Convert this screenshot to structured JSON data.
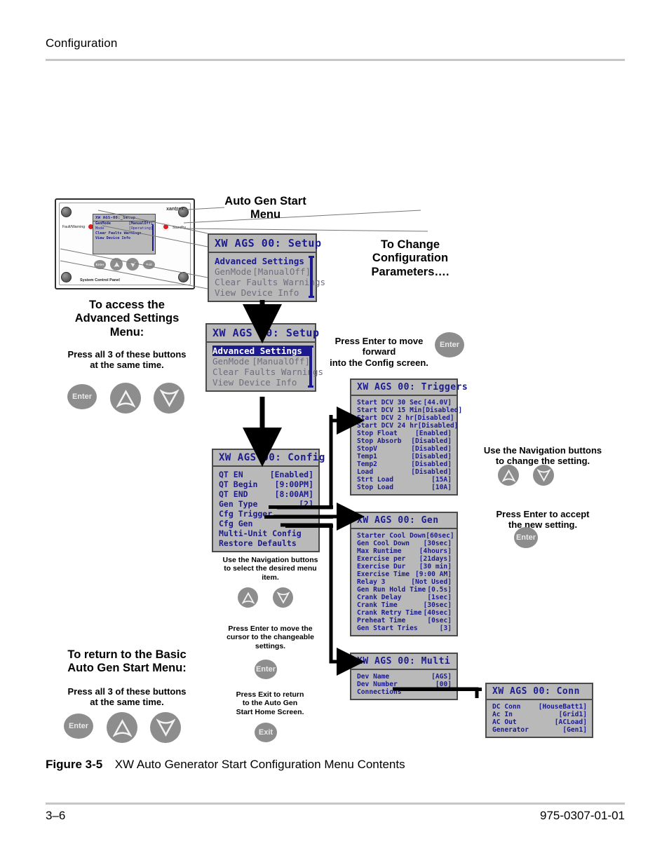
{
  "page": {
    "running_head": "Configuration",
    "figure_label": "Figure 3-5",
    "figure_title": "XW Auto Generator Start Configuration Menu Contents",
    "folio_page": "3–6",
    "folio_doc": "975-0307-01-01"
  },
  "device": {
    "brand": "xantrex",
    "fault_label": "Fault/Warning",
    "standby_label": "Standby",
    "panel_name": "System Control Panel",
    "screen": {
      "title": "XW AGS-00:_Setup",
      "rows": [
        {
          "key": "GenMode",
          "value": "[ManualOff]"
        },
        {
          "key": "Mode",
          "value": "[Operating]"
        },
        {
          "key": "Clear Faults Warnings",
          "value": ""
        },
        {
          "key": "View Device Info",
          "value": ""
        }
      ]
    },
    "buttons": [
      "Enter",
      "up-arrow",
      "down-arrow",
      "Exit"
    ]
  },
  "callouts": {
    "auto_gen_start_menu": "Auto Gen Start\nMenu",
    "to_change_config": "To Change\nConfiguration\nParameters….",
    "access_advanced_title": "To access the\nAdvanced Settings\nMenu:",
    "access_advanced_sub": "Press all 3 of these buttons\nat the same time.",
    "press_enter_forward": "Press Enter to move forward\ninto the Config screen.",
    "nav_change_setting": "Use the Navigation buttons\nto change the setting.",
    "press_enter_accept": "Press Enter to accept\nthe new setting.",
    "nav_select_item": "Use the Navigation buttons\nto select the desired menu\nitem.",
    "press_enter_cursor": "Press Enter to move the\ncursor to the changeable\nsettings.",
    "press_exit_return": "Press Exit to return\nto the Auto Gen\nStart Home Screen.",
    "return_basic_title": "To return to the Basic\nAuto Gen Start Menu:",
    "return_basic_sub": "Press all 3 of these buttons\nat the same time."
  },
  "buttons": {
    "enter": "Enter",
    "exit": "Exit"
  },
  "screens": {
    "setup_top": {
      "title": "XW AGS 00: Setup",
      "rows": [
        {
          "key": "Advanced Settings",
          "value": "",
          "style": "bold"
        },
        {
          "key": "GenMode",
          "value": "[ManualOff]",
          "style": "dim"
        },
        {
          "key": "Clear Faults Warnings",
          "value": "",
          "style": "dim"
        },
        {
          "key": "View Device Info",
          "value": "",
          "style": "dim"
        }
      ]
    },
    "setup_advanced": {
      "title": "XW AGS 00: Setup",
      "rows": [
        {
          "key": "Advanced Settings",
          "value": "",
          "style": "sel"
        },
        {
          "key": "GenMode",
          "value": "[ManualOff]",
          "style": "dim"
        },
        {
          "key": "Clear Faults Warnings",
          "value": "",
          "style": "dim"
        },
        {
          "key": "View Device Info",
          "value": "",
          "style": "dim"
        }
      ]
    },
    "config": {
      "title": "XW AGS 00: Config",
      "rows": [
        {
          "key": "QT EN",
          "value": "[Enabled]"
        },
        {
          "key": "QT Begin",
          "value": "[9:00PM]"
        },
        {
          "key": "QT END",
          "value": "[8:00AM]"
        },
        {
          "key": "Gen Type",
          "value": "[2]"
        },
        {
          "key": "Cfg Trigger",
          "value": ""
        },
        {
          "key": "Cfg Gen",
          "value": ""
        },
        {
          "key": "Multi-Unit Config",
          "value": ""
        },
        {
          "key": "Restore Defaults",
          "value": ""
        }
      ]
    },
    "triggers": {
      "title": "XW AGS 00: Triggers",
      "rows": [
        {
          "key": "Start DCV 30 Sec",
          "value": "[44.0V]"
        },
        {
          "key": "Start DCV 15 Min",
          "value": "[Disabled]"
        },
        {
          "key": "Start DCV 2 hr",
          "value": "[Disabled]"
        },
        {
          "key": "Start DCV 24 hr",
          "value": "[Disabled]"
        },
        {
          "key": "Stop Float",
          "value": "[Enabled]"
        },
        {
          "key": "Stop Absorb",
          "value": "[Disabled]"
        },
        {
          "key": "StopV",
          "value": "[Disabled]"
        },
        {
          "key": "Temp1",
          "value": "[Disabled]"
        },
        {
          "key": "Temp2",
          "value": "[Disabled]"
        },
        {
          "key": "Load",
          "value": "[Disabled]"
        },
        {
          "key": "Strt Load",
          "value": "[15A]"
        },
        {
          "key": "Stop Load",
          "value": "[10A]"
        }
      ]
    },
    "gen": {
      "title": "XW AGS 00: Gen",
      "rows": [
        {
          "key": "Starter Cool Down",
          "value": "[60sec]"
        },
        {
          "key": "Gen Cool Down",
          "value": "[30sec]"
        },
        {
          "key": "Max Runtime",
          "value": "[4hours]"
        },
        {
          "key": "Exercise per",
          "value": "[21days]"
        },
        {
          "key": "Exercise Dur",
          "value": "[30 min]"
        },
        {
          "key": "Exercise Time",
          "value": "[9:00 AM]"
        },
        {
          "key": "Relay 3",
          "value": "[Not Used]"
        },
        {
          "key": "Gen Run Hold Time",
          "value": "[0.5s]"
        },
        {
          "key": "Crank Delay",
          "value": "[1sec]"
        },
        {
          "key": "Crank Time",
          "value": "[30sec]"
        },
        {
          "key": "Crank Retry Time",
          "value": "[40sec]"
        },
        {
          "key": "Preheat Time",
          "value": "[0sec]"
        },
        {
          "key": "Gen Start Tries",
          "value": "[3]"
        }
      ]
    },
    "multi": {
      "title": "XW AGS 00: Multi",
      "rows": [
        {
          "key": "Dev Name",
          "value": "[AGS]"
        },
        {
          "key": "Dev Number",
          "value": "[00]"
        },
        {
          "key": "Connections",
          "value": ""
        }
      ]
    },
    "conn": {
      "title": "XW AGS 00: Conn",
      "rows": [
        {
          "key": "DC Conn",
          "value": "[HouseBatt1]"
        },
        {
          "key": "Ac In",
          "value": "[Grid1]"
        },
        {
          "key": "AC Out",
          "value": "[ACLoad]"
        },
        {
          "key": "Generator",
          "value": "[Gen1]"
        }
      ]
    }
  },
  "colors": {
    "lcd_background": "#b9b9b9",
    "lcd_text": "#1b1b8f",
    "lcd_border": "#4a4a4a",
    "button_gray": "#8d8d8d",
    "rule_gray": "#c6c6c6",
    "led_red": "#e01b1b"
  }
}
